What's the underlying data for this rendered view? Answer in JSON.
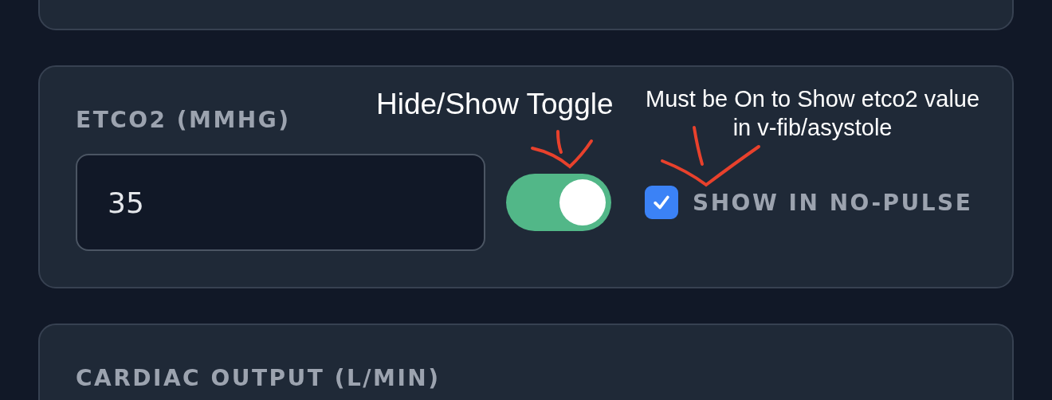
{
  "cards": [
    {
      "label": "ETCO2 (MMHG)",
      "value": "35",
      "toggle_on": true,
      "checkbox": {
        "label": "SHOW IN NO-PULSE",
        "checked": true
      }
    },
    {
      "label": "CARDIAC OUTPUT (L/MIN)"
    }
  ],
  "annotations": [
    {
      "kind": "toggle",
      "text": "Hide/Show Toggle"
    },
    {
      "kind": "checkbox",
      "lines": [
        "Must be On to Show etco2 value",
        "in v-fib/asystole"
      ]
    }
  ]
}
